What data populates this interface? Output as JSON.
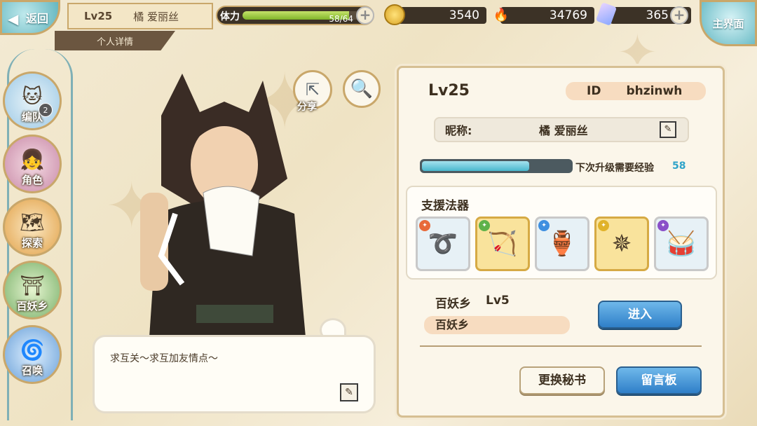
{
  "header": {
    "back_label": "返回",
    "level": "Lv25",
    "player_name": "橘 爱丽丝",
    "subtitle": "个人详情",
    "stamina": {
      "label": "体力",
      "current": 58,
      "max": 64,
      "text": "58/64"
    },
    "gold": "3540",
    "spirit": "34769",
    "gems": "365",
    "home_label": "主界面"
  },
  "nav": [
    {
      "label": "编队",
      "badge": "2"
    },
    {
      "label": "角色"
    },
    {
      "label": "探索"
    },
    {
      "label": "百妖乡"
    },
    {
      "label": "召唤"
    }
  ],
  "character": {
    "share_label": "分享",
    "message": "求互关～求互加友情点～"
  },
  "profile": {
    "level": "Lv25",
    "id_label": "ID",
    "id_value": "bhzinwh",
    "nickname_label": "昵称:",
    "nickname": "橘 爱丽丝",
    "exp_label": "下次升级需要经验",
    "exp_value": "58",
    "exp_progress": 0.72,
    "support_title": "支援法器",
    "artifacts": [
      {
        "icon": "golden-bangle-icon",
        "element": "fire",
        "rarity": "silver"
      },
      {
        "icon": "crossbow-icon",
        "element": "wind",
        "rarity": "gold"
      },
      {
        "icon": "gourd-icon",
        "element": "water",
        "rarity": "silver"
      },
      {
        "icon": "ornament-icon",
        "element": "earth",
        "rarity": "gold"
      },
      {
        "icon": "red-drum-icon",
        "element": "dark",
        "rarity": "silver"
      }
    ],
    "village_label": "百妖乡",
    "village_level": "Lv5",
    "village_name": "百妖乡",
    "enter_button": "进入",
    "change_secretary_button": "更换秘书",
    "message_board_button": "留言板"
  }
}
